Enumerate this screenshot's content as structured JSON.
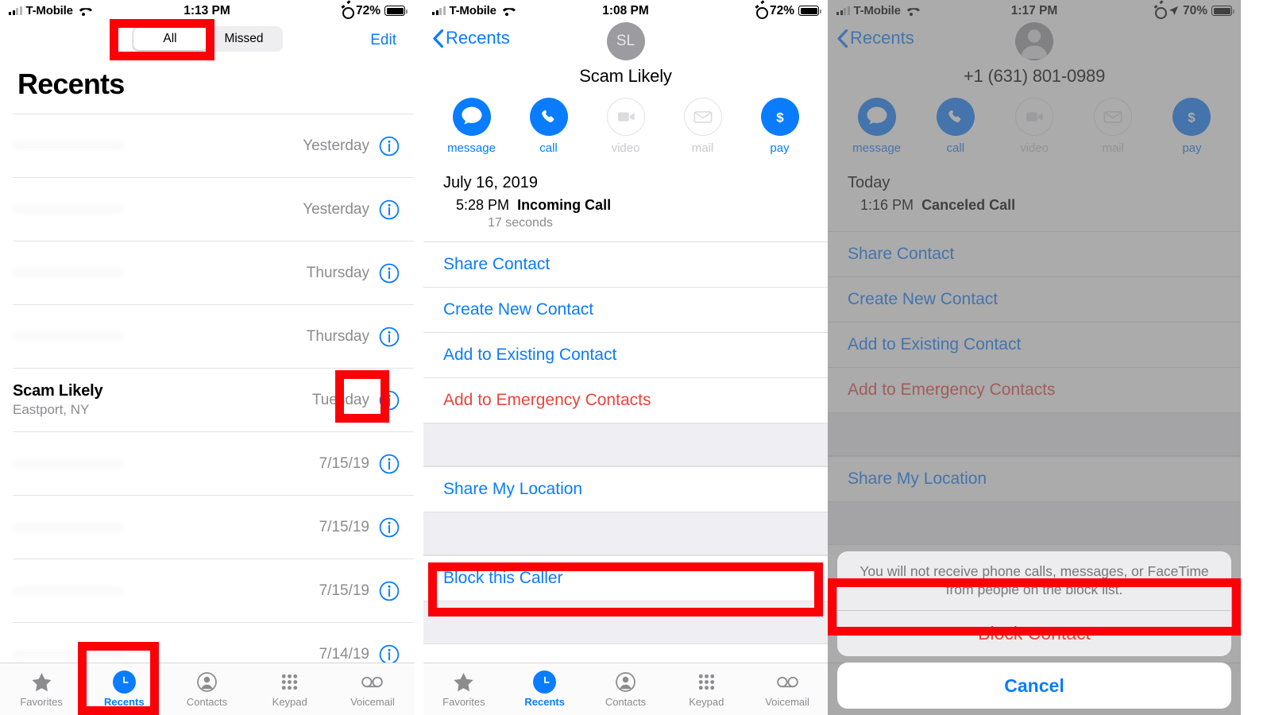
{
  "panels": [
    {
      "status": {
        "carrier": "T-Mobile",
        "time": "1:13 PM",
        "battery": "72%"
      },
      "segmented": {
        "all": "All",
        "missed": "Missed"
      },
      "edit": "Edit",
      "title": "Recents",
      "calls": [
        {
          "name": "",
          "sub": "",
          "date": "Yesterday",
          "redacted": true
        },
        {
          "name": "",
          "sub": "",
          "date": "Yesterday",
          "redacted": true
        },
        {
          "name": "",
          "sub": "",
          "date": "Thursday",
          "redacted": true
        },
        {
          "name": "",
          "sub": "",
          "date": "Thursday",
          "redacted": true
        },
        {
          "name": "Scam Likely",
          "sub": "Eastport, NY",
          "date": "Tuesday",
          "redacted": false
        },
        {
          "name": "",
          "sub": "",
          "date": "7/15/19",
          "redacted": true
        },
        {
          "name": "",
          "sub": "",
          "date": "7/15/19",
          "redacted": true
        },
        {
          "name": "",
          "sub": "",
          "date": "7/15/19",
          "redacted": true
        },
        {
          "name": "",
          "sub": "",
          "date": "7/14/19",
          "redacted": true
        }
      ]
    },
    {
      "status": {
        "carrier": "T-Mobile",
        "time": "1:08 PM",
        "battery": "72%"
      },
      "back": "Recents",
      "avatar_initials": "SL",
      "contact_name": "Scam Likely",
      "actions": [
        {
          "label": "message",
          "icon": "message-icon",
          "enabled": true
        },
        {
          "label": "call",
          "icon": "phone-icon",
          "enabled": true
        },
        {
          "label": "video",
          "icon": "video-icon",
          "enabled": false
        },
        {
          "label": "mail",
          "icon": "mail-icon",
          "enabled": false
        },
        {
          "label": "pay",
          "icon": "dollar-icon",
          "enabled": true
        }
      ],
      "call_log": {
        "date": "July 16, 2019",
        "time": "5:28 PM",
        "type": "Incoming Call",
        "duration": "17 seconds"
      },
      "rows": [
        {
          "label": "Share Contact",
          "style": "link"
        },
        {
          "label": "Create New Contact",
          "style": "link"
        },
        {
          "label": "Add to Existing Contact",
          "style": "link"
        },
        {
          "label": "Add to Emergency Contacts",
          "style": "danger"
        },
        {
          "label": "Share My Location",
          "style": "link"
        },
        {
          "label": "Block this Caller",
          "style": "link"
        }
      ]
    },
    {
      "status": {
        "carrier": "T-Mobile",
        "time": "1:17 PM",
        "battery": "70%"
      },
      "back": "Recents",
      "contact_name": "+1 (631) 801-0989",
      "actions": [
        {
          "label": "message",
          "icon": "message-icon",
          "enabled": true
        },
        {
          "label": "call",
          "icon": "phone-icon",
          "enabled": true
        },
        {
          "label": "video",
          "icon": "video-icon",
          "enabled": false
        },
        {
          "label": "mail",
          "icon": "mail-icon",
          "enabled": false
        },
        {
          "label": "pay",
          "icon": "dollar-icon",
          "enabled": true
        }
      ],
      "call_log": {
        "date": "Today",
        "time": "1:16 PM",
        "type": "Canceled Call"
      },
      "rows": [
        {
          "label": "Share Contact",
          "style": "link"
        },
        {
          "label": "Create New Contact",
          "style": "link"
        },
        {
          "label": "Add to Existing Contact",
          "style": "link"
        },
        {
          "label": "Add to Emergency Contacts",
          "style": "danger"
        },
        {
          "label": "Share My Location",
          "style": "link"
        }
      ],
      "action_sheet": {
        "message": "You will not receive phone calls, messages, or FaceTime from people on the block list.",
        "confirm": "Block Contact",
        "cancel": "Cancel"
      }
    }
  ],
  "tabbar": {
    "items": [
      {
        "label": "Favorites",
        "icon": "star-icon"
      },
      {
        "label": "Recents",
        "icon": "clock-icon"
      },
      {
        "label": "Contacts",
        "icon": "person-circle-icon"
      },
      {
        "label": "Keypad",
        "icon": "keypad-icon"
      },
      {
        "label": "Voicemail",
        "icon": "voicemail-icon"
      }
    ],
    "active": "Recents"
  },
  "colors": {
    "accent_blue": "#0a7cff",
    "danger_red": "#e8453c",
    "highlight_red": "#fb0007",
    "muted_gray": "#8b8b90"
  }
}
